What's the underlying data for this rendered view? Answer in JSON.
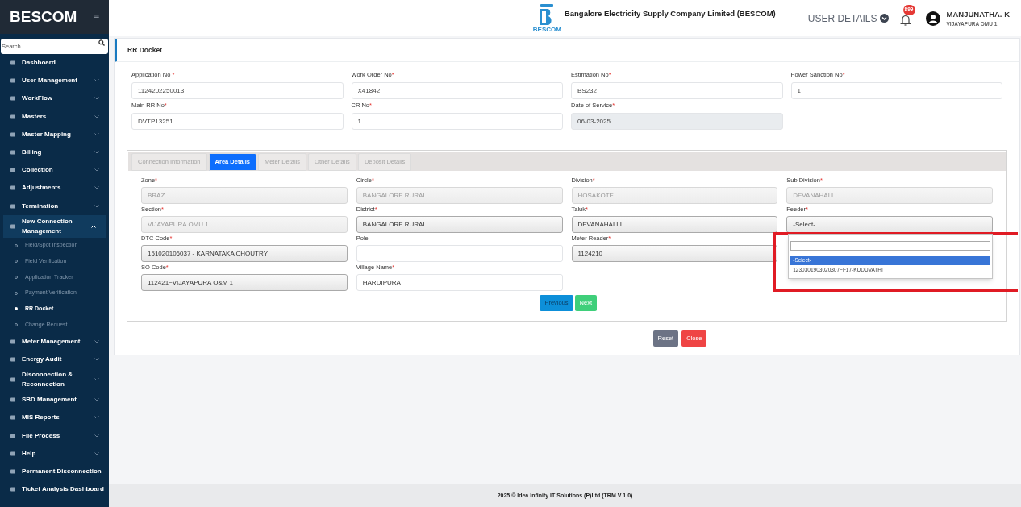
{
  "sidebar": {
    "brand": "BESCOM",
    "menu_glyph": "≡",
    "search": {
      "placeholder": "Search.."
    },
    "items": [
      {
        "label": "Dashboard",
        "kind": "link"
      },
      {
        "label": "User Management",
        "kind": "group",
        "expanded": false
      },
      {
        "label": "WorkFlow",
        "kind": "group",
        "expanded": false
      },
      {
        "label": "Masters",
        "kind": "group",
        "expanded": false
      },
      {
        "label": "Master Mapping",
        "kind": "group",
        "expanded": false
      },
      {
        "label": "Billing",
        "kind": "group",
        "expanded": false
      },
      {
        "label": "Collection",
        "kind": "group",
        "expanded": false
      },
      {
        "label": "Adjustments",
        "kind": "group",
        "expanded": false
      },
      {
        "label": "Termination",
        "kind": "group",
        "expanded": false
      },
      {
        "label": "New Connection Management",
        "kind": "group",
        "expanded": true,
        "children": [
          {
            "label": "Field/Spot Inspection",
            "selected": false
          },
          {
            "label": "Field Verification",
            "selected": false
          },
          {
            "label": "Application Tracker",
            "selected": false
          },
          {
            "label": "Payment Verification",
            "selected": false
          },
          {
            "label": "RR Docket",
            "selected": true
          },
          {
            "label": "Change Request",
            "selected": false
          }
        ]
      },
      {
        "label": "Meter Management",
        "kind": "group",
        "expanded": false
      },
      {
        "label": "Energy Audit",
        "kind": "group",
        "expanded": false
      },
      {
        "label": "Disconnection & Reconnection",
        "kind": "group",
        "expanded": false
      },
      {
        "label": "SBD Management",
        "kind": "group",
        "expanded": false
      },
      {
        "label": "MIS Reports",
        "kind": "group",
        "expanded": false
      },
      {
        "label": "File Process",
        "kind": "group",
        "expanded": false
      },
      {
        "label": "Help",
        "kind": "group",
        "expanded": false
      },
      {
        "label": "Permanent Disconnection",
        "kind": "link"
      },
      {
        "label": "Ticket Analysis Dashboard",
        "kind": "link"
      }
    ]
  },
  "header": {
    "logo_caption": "BESCOM",
    "org_name": "Bangalore Electricity Supply Company Limited (BESCOM)",
    "user_details": "USER DETAILS",
    "notification_count": "899",
    "user_name": "MANJUNATHA. K",
    "user_location": "VIJAYAPURA OMU 1"
  },
  "page_title": "RR Docket",
  "docket_fields": [
    {
      "label": "Application No ",
      "required_mark": "*",
      "value": "1124202250013",
      "disabled": false
    },
    {
      "label": "Work Order No",
      "required_mark": "*",
      "value": "X41842",
      "disabled": false
    },
    {
      "label": "Estimation No",
      "required_mark": "*",
      "value": "BS232",
      "disabled": false
    },
    {
      "label": "Power Sanction No",
      "required_mark": "*",
      "value": "1",
      "disabled": false
    },
    {
      "label": "Main RR No",
      "required_mark": "*",
      "value": "DVTP13251",
      "disabled": false
    },
    {
      "label": "CR No",
      "required_mark": "*",
      "value": "1",
      "disabled": false
    },
    {
      "label": "Date of Service",
      "required_mark": "*",
      "value": "06-03-2025",
      "disabled": true
    }
  ],
  "tabs": [
    {
      "label": "Connection Information",
      "selected": false
    },
    {
      "label": "Area Details",
      "selected": true
    },
    {
      "label": "Meter Details",
      "selected": false
    },
    {
      "label": "Other Details",
      "selected": false
    },
    {
      "label": "Deposit Details",
      "selected": false
    }
  ],
  "area_rows": [
    [
      {
        "label": "Zone",
        "required_mark": "*",
        "kind": "readonly",
        "value": "BRAZ"
      },
      {
        "label": "Circle",
        "required_mark": "*",
        "kind": "readonly",
        "value": "BANGALORE RURAL"
      },
      {
        "label": "Division",
        "required_mark": "*",
        "kind": "readonly",
        "value": "HOSAKOTE"
      },
      {
        "label": "Sub Division",
        "required_mark": "*",
        "kind": "readonly",
        "value": "DEVANAHALLI"
      }
    ],
    [
      {
        "label": "Section",
        "required_mark": "*",
        "kind": "readonly",
        "value": "VIJAYAPURA OMU 1"
      },
      {
        "label": "District",
        "required_mark": "*",
        "kind": "select",
        "value": "BANGALORE RURAL"
      },
      {
        "label": "Taluk",
        "required_mark": "*",
        "kind": "select",
        "value": "DEVANAHALLI"
      },
      {
        "label": "Feeder",
        "required_mark": "*",
        "kind": "dropdown",
        "value": "-Select-",
        "options": [
          {
            "label": "-Select-",
            "selected": true
          },
          {
            "label": "1230301903020307~F17-KUDUVATHI",
            "selected": false
          }
        ]
      }
    ],
    [
      {
        "label": "DTC Code",
        "required_mark": "*",
        "kind": "select",
        "value": "151020106037 - KARNATAKA CHOUTRY"
      },
      {
        "label": "Pole",
        "kind": "input"
      },
      {
        "label": "Meter Reader",
        "required_mark": "*",
        "kind": "select",
        "value": "1124210"
      }
    ],
    [
      {
        "label": "SO Code",
        "required_mark": "*",
        "kind": "select",
        "value": "112421~VIJAYAPURA O&M 1"
      },
      {
        "label": "Village Name",
        "required_mark": "*",
        "kind": "input",
        "value": "HARDIPURA"
      }
    ]
  ],
  "tab_buttons": [
    {
      "label": "Previous",
      "kind": "previous"
    },
    {
      "label": "Next",
      "kind": "next"
    }
  ],
  "form_buttons": [
    {
      "label": "Reset",
      "kind": "reset"
    },
    {
      "label": "Close",
      "kind": "close"
    }
  ],
  "footer": "2025 © Idea Infinity IT Solutions (P)Ltd.(TRM V 1.0)"
}
